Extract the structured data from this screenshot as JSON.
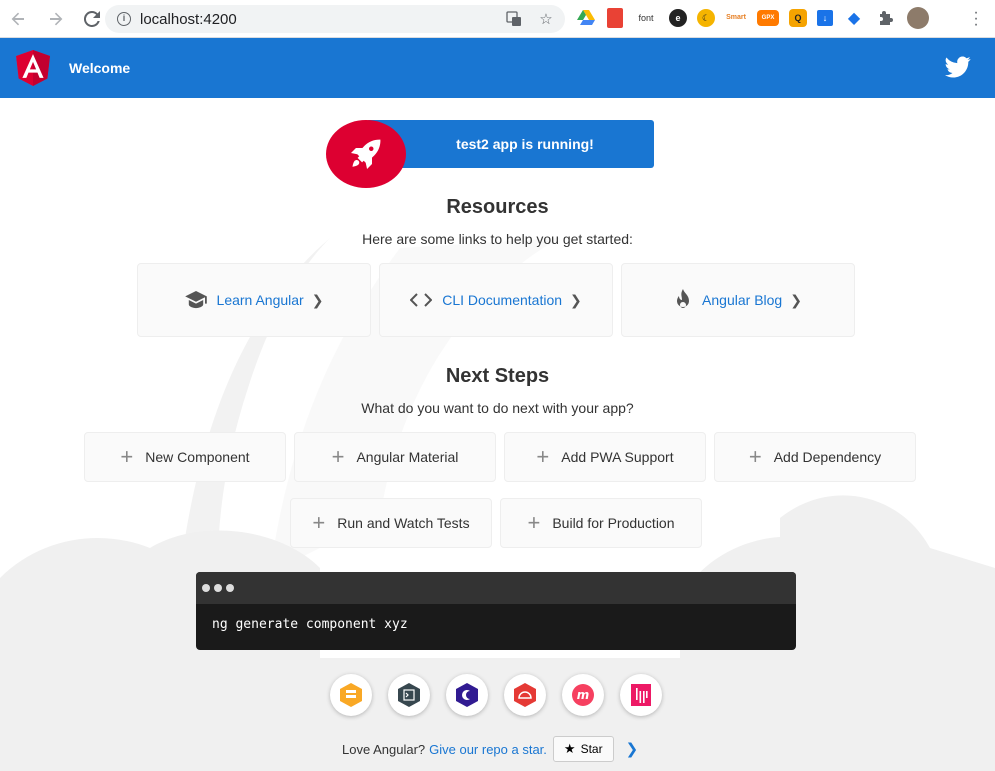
{
  "browser": {
    "url": "localhost:4200",
    "extension_font_label": "font",
    "extension_smart_label": "Smart",
    "extension_gpx_label": "GPX"
  },
  "toolbar": {
    "title": "Welcome"
  },
  "banner": {
    "running_text": "test2 app is running!"
  },
  "resources": {
    "title": "Resources",
    "subtitle": "Here are some links to help you get started:",
    "cards": [
      {
        "label": "Learn Angular",
        "icon": "graduation-cap-icon"
      },
      {
        "label": "CLI Documentation",
        "icon": "code-brackets-icon"
      },
      {
        "label": "Angular Blog",
        "icon": "flame-icon"
      }
    ]
  },
  "next_steps": {
    "title": "Next Steps",
    "subtitle": "What do you want to do next with your app?",
    "cards": [
      {
        "label": "New Component"
      },
      {
        "label": "Angular Material"
      },
      {
        "label": "Add PWA Support"
      },
      {
        "label": "Add Dependency"
      },
      {
        "label": "Run and Watch Tests"
      },
      {
        "label": "Build for Production"
      }
    ]
  },
  "terminal": {
    "command": "ng generate component xyz"
  },
  "footer": {
    "love_text": "Love Angular?",
    "repo_link": "Give our repo a star.",
    "star_label": "Star"
  },
  "colors": {
    "primary": "#1976d2",
    "angular_red": "#dd0031",
    "terminal_bg": "#1a1a1a"
  }
}
